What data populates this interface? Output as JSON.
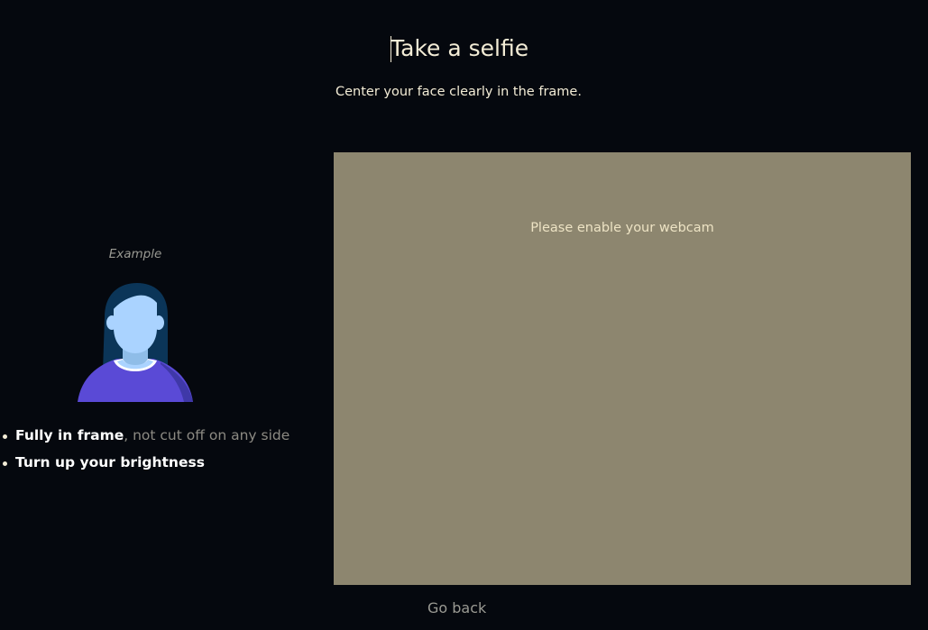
{
  "header": {
    "title": "Take a selfie",
    "subtitle": "Center your face clearly in the frame."
  },
  "example": {
    "label": "Example",
    "image_icon": "person-avatar-illustration"
  },
  "tips": [
    {
      "strong": "Fully in frame",
      "rest": ", not cut off on any side"
    },
    {
      "strong": "Turn up your brightness",
      "rest": ""
    }
  ],
  "webcam": {
    "message": "Please enable your webcam"
  },
  "footer": {
    "go_back_label": "Go back"
  },
  "colors": {
    "background": "#05080e",
    "text_primary": "#f3ecd6",
    "text_muted": "#8c8a83",
    "webcam_placeholder": "#8d866f",
    "avatar_hair": "#0b3558",
    "avatar_skin": "#aad3ff",
    "avatar_shirt": "#5a4ad6"
  }
}
